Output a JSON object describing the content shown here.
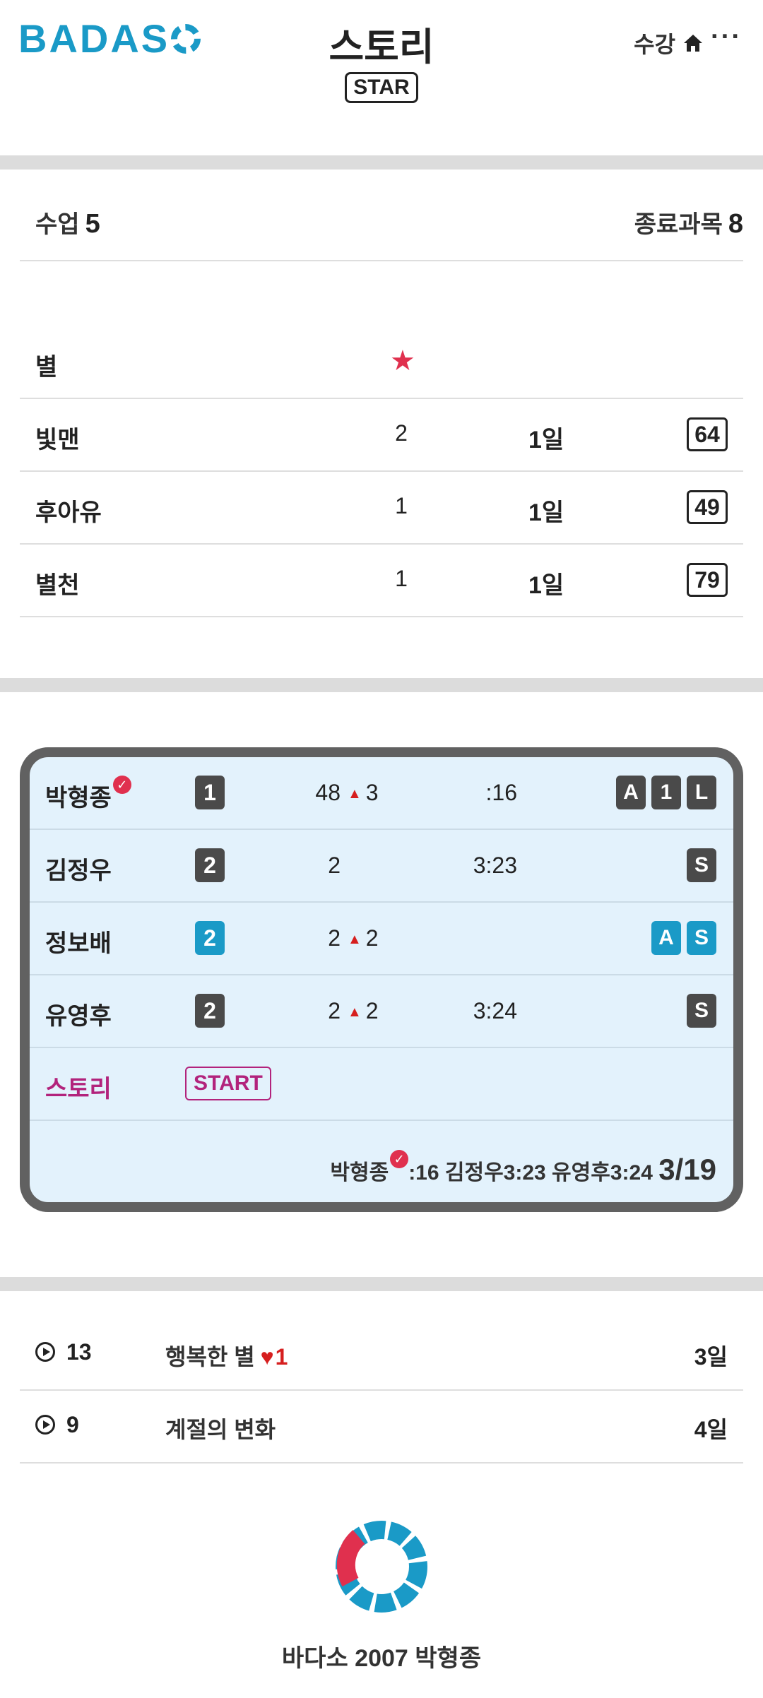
{
  "header": {
    "logo_text": "BADAS",
    "title": "스토리",
    "badge": "STAR",
    "right_label": "수강",
    "more": "···"
  },
  "summary": {
    "left_label": "수업",
    "left_value": "5",
    "right_label": "종료과목",
    "right_value": "8"
  },
  "star_table": {
    "header_label": "별",
    "rows": [
      {
        "name": "빛맨",
        "count": "2",
        "days": "1일",
        "score": "64"
      },
      {
        "name": "후아유",
        "count": "1",
        "days": "1일",
        "score": "49"
      },
      {
        "name": "별천",
        "count": "1",
        "days": "1일",
        "score": "79"
      }
    ]
  },
  "ranking": {
    "rows": [
      {
        "name": "박형종",
        "check": "✓",
        "rank": "1",
        "score": "48",
        "up": "3",
        "time": ":16",
        "badges": [
          "A",
          "1",
          "L"
        ]
      },
      {
        "name": "김정우",
        "rank": "2",
        "score": "2",
        "up": "",
        "time": "3:23",
        "badges": [
          "S"
        ]
      },
      {
        "name": "정보배",
        "rank": "2",
        "score": "2",
        "up": "2",
        "time": "",
        "badges": [
          "A",
          "S"
        ]
      },
      {
        "name": "유영후",
        "rank": "2",
        "score": "2",
        "up": "2",
        "time": "3:24",
        "badges": [
          "S"
        ]
      }
    ],
    "story_label": "스토리",
    "start_label": "START",
    "footer_name1": "박형종",
    "footer_rest": ":16 김정우3:23 유영후3:24",
    "footer_count": "3/19"
  },
  "stories": [
    {
      "count": "13",
      "title": "행복한 별",
      "hearts": "1",
      "age": "3일"
    },
    {
      "count": "9",
      "title": "계절의 변화",
      "hearts": "",
      "age": "4일"
    }
  ],
  "footer": {
    "text": "바다소 2007 박형종"
  },
  "colors": {
    "brand": "#1a9ac7",
    "accent_red": "#e0304e",
    "story_pink": "#b2237c",
    "card_bg": "#e3f2fc"
  }
}
